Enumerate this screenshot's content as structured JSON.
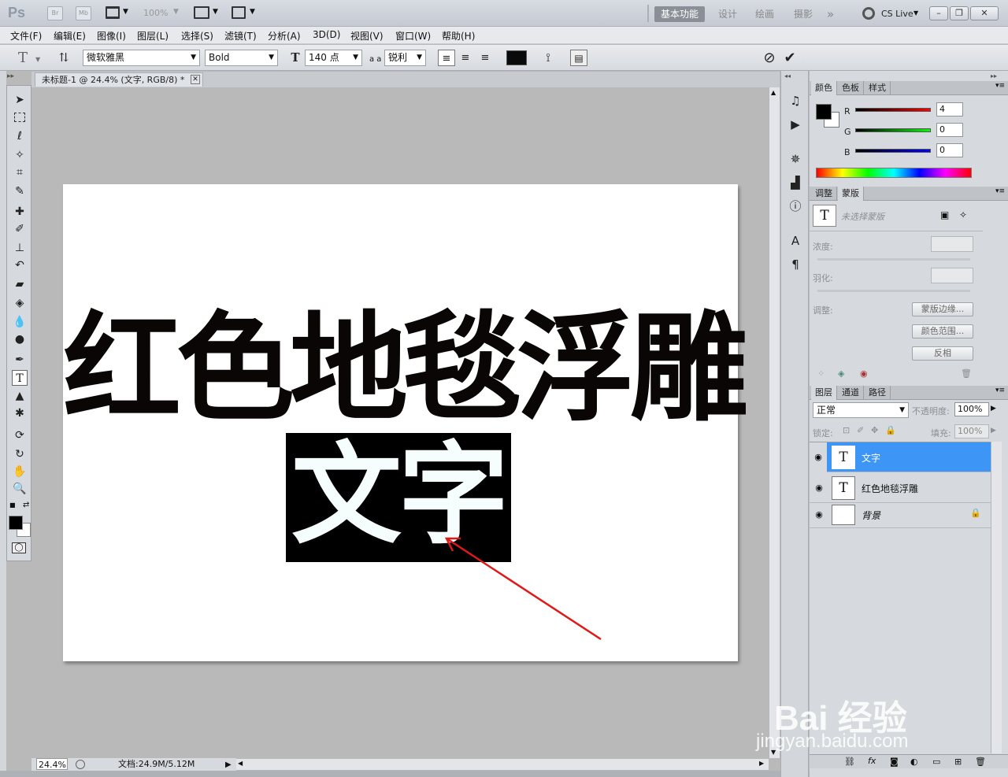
{
  "titlebar": {
    "logo": "Ps",
    "bridge": "Br",
    "mini_bridge": "Mb",
    "zoom": "100%",
    "workspaces": [
      "基本功能",
      "设计",
      "绘画",
      "摄影"
    ],
    "more": "»",
    "cs_live": "CS Live"
  },
  "menu": [
    "文件(F)",
    "编辑(E)",
    "图像(I)",
    "图层(L)",
    "选择(S)",
    "滤镜(T)",
    "分析(A)",
    "3D(D)",
    "视图(V)",
    "窗口(W)",
    "帮助(H)"
  ],
  "options": {
    "font_family": "微软雅黑",
    "font_style": "Bold",
    "font_size": "140 点",
    "aa_label": "a a",
    "antialias": "锐利",
    "text_color": "#0a0a0a"
  },
  "document": {
    "tab_title": "未标题-1 @ 24.4% (文字, RGB/8) *",
    "heading": "红色地毯浮雕",
    "selected_text": "文字"
  },
  "status": {
    "zoom": "24.4%",
    "doc_info": "文档:24.9M/5.12M"
  },
  "color_panel": {
    "tabs": [
      "颜色",
      "色板",
      "样式"
    ],
    "r_label": "R",
    "r": "4",
    "g_label": "G",
    "g": "0",
    "b_label": "B",
    "b": "0"
  },
  "adjust_panel": {
    "tabs": [
      "调整",
      "蒙版"
    ],
    "no_mask": "未选择蒙版",
    "density": "浓度:",
    "feather": "羽化:",
    "refine": "调整:",
    "mask_edge": "蒙版边缘...",
    "color_range": "颜色范围...",
    "invert": "反相"
  },
  "layers_panel": {
    "tabs": [
      "图层",
      "通道",
      "路径"
    ],
    "blend": "正常",
    "opacity_label": "不透明度:",
    "opacity": "100%",
    "lock_label": "锁定:",
    "fill_label": "填充:",
    "fill": "100%",
    "layers": [
      {
        "name": "文字",
        "thumb": "T",
        "selected": true
      },
      {
        "name": "红色地毯浮雕",
        "thumb": "T",
        "selected": false
      },
      {
        "name": "背景",
        "thumb": "",
        "selected": false
      }
    ]
  },
  "watermark": {
    "line1": "Bai 经验",
    "line2": "jingyan.baidu.com"
  },
  "colors": {
    "selection_highlight": "#3d95f5",
    "arrow": "#e01818"
  }
}
